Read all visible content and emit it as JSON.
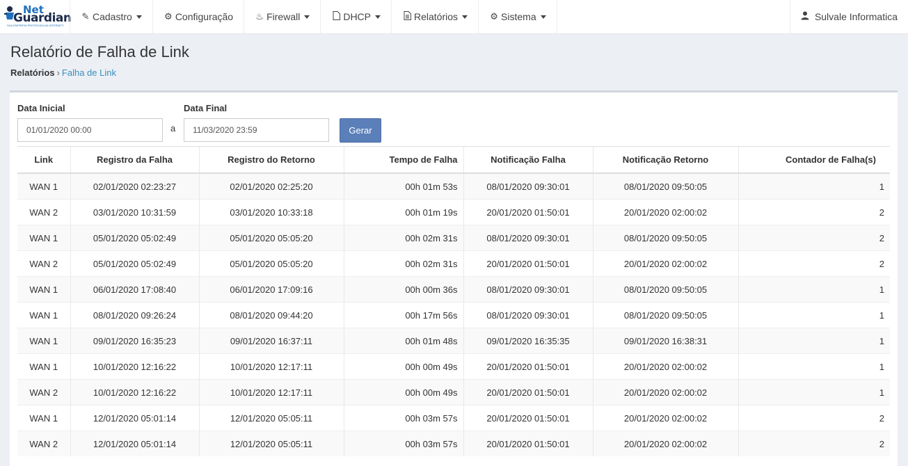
{
  "brand": {
    "name_top": "Net",
    "name_bottom": "Guardian",
    "tagline": "SUA EMPRESA PROTEGIDA NA INTERNET!"
  },
  "nav": [
    {
      "label": "Cadastro",
      "icon": "edit-icon",
      "dropdown": true
    },
    {
      "label": "Configuração",
      "icon": "gear-icon",
      "dropdown": false
    },
    {
      "label": "Firewall",
      "icon": "fire-icon",
      "dropdown": true
    },
    {
      "label": "DHCP",
      "icon": "file-icon",
      "dropdown": true
    },
    {
      "label": "Relatórios",
      "icon": "file-text-icon",
      "dropdown": true
    },
    {
      "label": "Sistema",
      "icon": "gears-icon",
      "dropdown": true
    }
  ],
  "user": {
    "name": "Sulvale Informatica",
    "icon": "user-icon"
  },
  "page": {
    "title": "Relatório de Falha de Link"
  },
  "breadcrumb": {
    "root": "Relatórios",
    "current": "Falha de Link"
  },
  "filter": {
    "start_label": "Data Inicial",
    "start_value": "01/01/2020 00:00",
    "between": "a",
    "end_label": "Data Final",
    "end_value": "11/03/2020 23:59",
    "submit_label": "Gerar"
  },
  "table": {
    "headers": [
      "Link",
      "Registro da Falha",
      "Registro do Retorno",
      "Tempo de Falha",
      "Notificação Falha",
      "Notificação Retorno",
      "Contador de Falha(s)"
    ],
    "rows": [
      [
        "WAN 1",
        "02/01/2020 02:23:27",
        "02/01/2020 02:25:20",
        "00h 01m 53s",
        "08/01/2020 09:30:01",
        "08/01/2020 09:50:05",
        "1"
      ],
      [
        "WAN 2",
        "03/01/2020 10:31:59",
        "03/01/2020 10:33:18",
        "00h 01m 19s",
        "20/01/2020 01:50:01",
        "20/01/2020 02:00:02",
        "2"
      ],
      [
        "WAN 1",
        "05/01/2020 05:02:49",
        "05/01/2020 05:05:20",
        "00h 02m 31s",
        "08/01/2020 09:30:01",
        "08/01/2020 09:50:05",
        "2"
      ],
      [
        "WAN 2",
        "05/01/2020 05:02:49",
        "05/01/2020 05:05:20",
        "00h 02m 31s",
        "20/01/2020 01:50:01",
        "20/01/2020 02:00:02",
        "2"
      ],
      [
        "WAN 1",
        "06/01/2020 17:08:40",
        "06/01/2020 17:09:16",
        "00h 00m 36s",
        "08/01/2020 09:30:01",
        "08/01/2020 09:50:05",
        "1"
      ],
      [
        "WAN 1",
        "08/01/2020 09:26:24",
        "08/01/2020 09:44:20",
        "00h 17m 56s",
        "08/01/2020 09:30:01",
        "08/01/2020 09:50:05",
        "1"
      ],
      [
        "WAN 1",
        "09/01/2020 16:35:23",
        "09/01/2020 16:37:11",
        "00h 01m 48s",
        "09/01/2020 16:35:35",
        "09/01/2020 16:38:31",
        "1"
      ],
      [
        "WAN 1",
        "10/01/2020 12:16:22",
        "10/01/2020 12:17:11",
        "00h 00m 49s",
        "20/01/2020 01:50:01",
        "20/01/2020 02:00:02",
        "1"
      ],
      [
        "WAN 2",
        "10/01/2020 12:16:22",
        "10/01/2020 12:17:11",
        "00h 00m 49s",
        "20/01/2020 01:50:01",
        "20/01/2020 02:00:02",
        "1"
      ],
      [
        "WAN 1",
        "12/01/2020 05:01:14",
        "12/01/2020 05:05:11",
        "00h 03m 57s",
        "20/01/2020 01:50:01",
        "20/01/2020 02:00:02",
        "2"
      ],
      [
        "WAN 2",
        "12/01/2020 05:01:14",
        "12/01/2020 05:05:11",
        "00h 03m 57s",
        "20/01/2020 01:50:01",
        "20/01/2020 02:00:02",
        "2"
      ]
    ]
  }
}
